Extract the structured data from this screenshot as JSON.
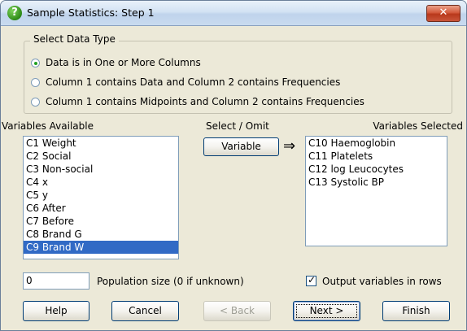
{
  "window": {
    "title": "Sample Statistics: Step 1",
    "close_symbol": "✕"
  },
  "data_type": {
    "legend": "Select Data Type",
    "options": [
      {
        "label": "Data is in One or More Columns",
        "checked": true
      },
      {
        "label": "Column 1 contains Data and Column 2 contains Frequencies",
        "checked": false
      },
      {
        "label": "Column 1 contains Midpoints and Column 2 contains Frequencies",
        "checked": false
      }
    ]
  },
  "available": {
    "label": "Variables Available",
    "items": [
      "C1 Weight",
      "C2 Social",
      "C3 Non-social",
      "C4 x",
      "C5 y",
      "C6 After",
      "C7 Before",
      "C8 Brand G",
      "C9 Brand W"
    ],
    "selected_index": 8
  },
  "select_omit": {
    "label": "Select / Omit",
    "button_label": "Variable",
    "arrow": "⇒"
  },
  "selected": {
    "label": "Variables Selected",
    "items": [
      "C10 Haemoglobin",
      "C11 Platelets",
      "C12 log Leucocytes",
      "C13 Systolic BP"
    ]
  },
  "population": {
    "value": "0",
    "label": "Population size (0 if unknown)"
  },
  "output_rows": {
    "label": "Output variables in rows",
    "checked": true
  },
  "buttons": {
    "help": "Help",
    "cancel": "Cancel",
    "back": "< Back",
    "next": "Next >",
    "finish": "Finish"
  }
}
